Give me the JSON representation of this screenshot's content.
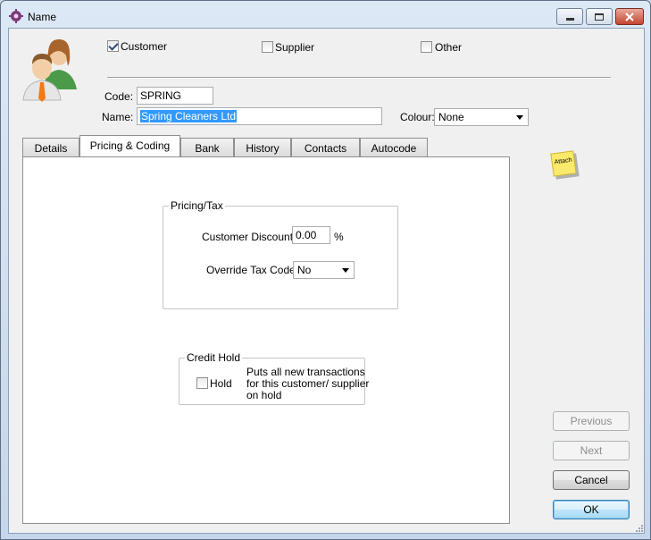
{
  "window": {
    "title": "Name"
  },
  "types": {
    "customer": {
      "label": "Customer",
      "checked": true
    },
    "supplier": {
      "label": "Supplier",
      "checked": false
    },
    "other": {
      "label": "Other",
      "checked": false
    }
  },
  "code": {
    "label": "Code:",
    "value": "SPRING"
  },
  "name": {
    "label": "Name:",
    "value": "Spring Cleaners Ltd"
  },
  "colour": {
    "label": "Colour:",
    "value": "None"
  },
  "tabs": [
    {
      "label": "Details",
      "active": false
    },
    {
      "label": "Pricing & Coding",
      "active": true
    },
    {
      "label": "Bank",
      "active": false
    },
    {
      "label": "History",
      "active": false
    },
    {
      "label": "Contacts",
      "active": false
    },
    {
      "label": "Autocode",
      "active": false
    }
  ],
  "pricing": {
    "group_title": "Pricing/Tax",
    "discount_label": "Customer Discount:",
    "discount_value": "0.00",
    "discount_unit": "%",
    "tax_label": "Override Tax Code:",
    "tax_value": "No"
  },
  "credit_hold": {
    "group_title": "Credit Hold",
    "hold_label": "Hold",
    "hold_checked": false,
    "description_line1": "Puts all new transactions",
    "description_line2": "for this customer/ supplier",
    "description_line3": "on hold"
  },
  "note": {
    "label": "Attach"
  },
  "buttons": {
    "previous": "Previous",
    "next": "Next",
    "cancel": "Cancel",
    "ok": "OK"
  },
  "colors": {
    "selection": "#3399ff",
    "accent": "#3c7fb1"
  }
}
